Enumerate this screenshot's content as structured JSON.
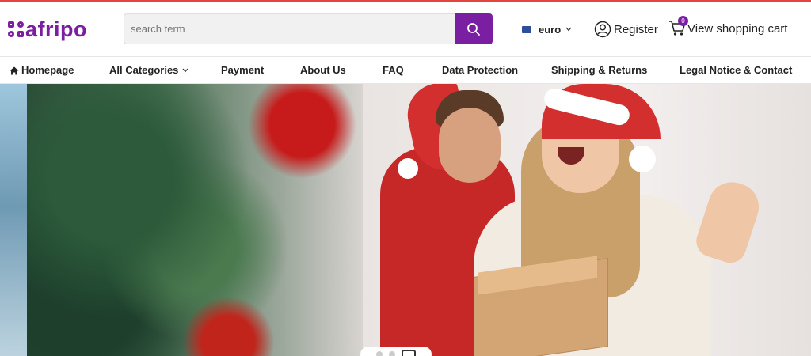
{
  "brand": {
    "name": "afripo",
    "accent": "#7b1fa2",
    "top_border": "#e0463f"
  },
  "search": {
    "placeholder": "search term",
    "icon": "search-icon"
  },
  "currency": {
    "label": "euro",
    "icon": "chevron-down-icon"
  },
  "account": {
    "register_label": "Register",
    "icon": "user-circle-icon"
  },
  "cart": {
    "label": "View shopping cart",
    "count": "0",
    "icon": "cart-icon"
  },
  "nav": {
    "items": [
      {
        "label": "Homepage",
        "icon": "home-icon"
      },
      {
        "label": "All Categories",
        "icon": "chevron-down-icon"
      },
      {
        "label": "Payment"
      },
      {
        "label": "About Us"
      },
      {
        "label": "FAQ"
      },
      {
        "label": "Data Protection"
      },
      {
        "label": "Shipping & Returns"
      },
      {
        "label": "Legal Notice & Contact"
      }
    ]
  },
  "hero": {
    "slides": 3,
    "active_slide": 3
  }
}
